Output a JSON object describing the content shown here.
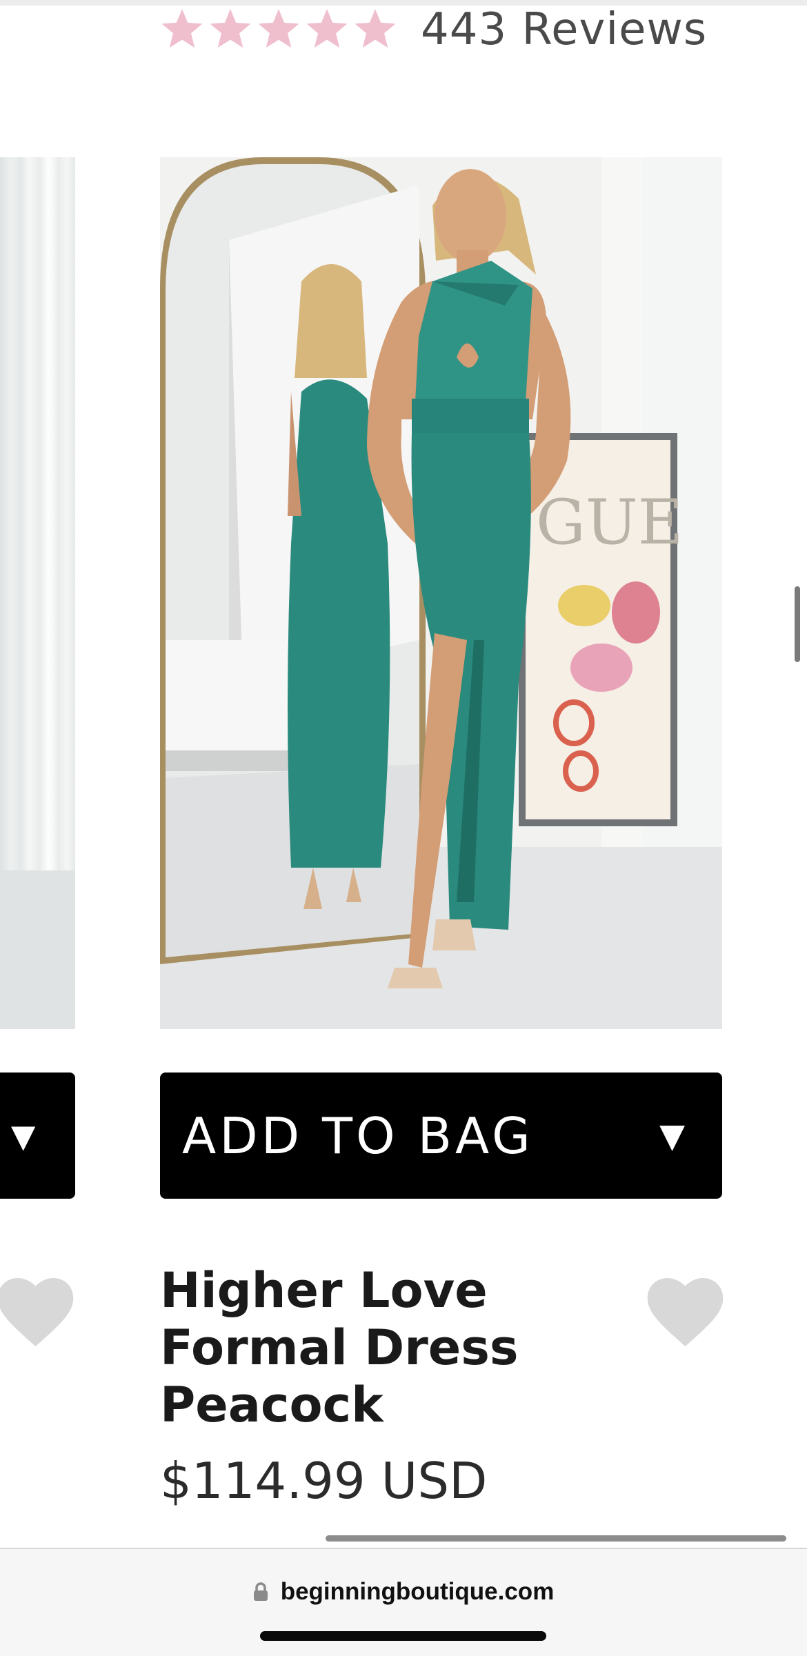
{
  "rating": {
    "stars": 5,
    "reviews_text": "443 Reviews",
    "star_color": "#f0bfcd"
  },
  "previous_card": {
    "add_arrow": "▼"
  },
  "product": {
    "image_alt": "Higher Love Formal Dress Peacock",
    "add_to_bag_label": "ADD TO BAG",
    "add_to_bag_arrow": "▼",
    "title": "Higher Love Formal Dress Peacock",
    "price": "$114.99 USD",
    "dress_color": "#2a8a7e"
  },
  "browser": {
    "url": "beginningboutique.com"
  },
  "icons": {
    "star": "star-icon",
    "heart": "heart-icon",
    "lock": "lock-icon",
    "dropdown": "chevron-down-icon"
  }
}
